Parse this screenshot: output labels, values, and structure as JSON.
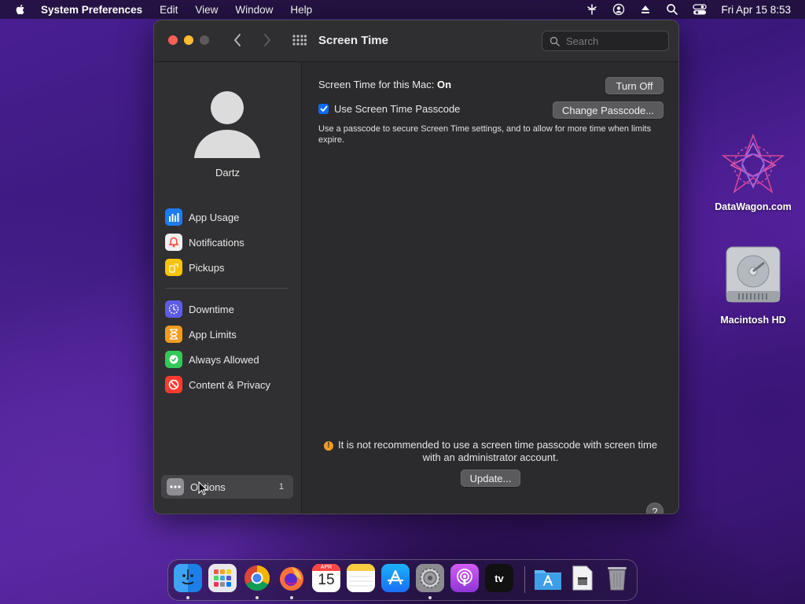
{
  "menubar": {
    "app_name": "System Preferences",
    "menus": [
      "Edit",
      "View",
      "Window",
      "Help"
    ],
    "datetime": "Fri Apr 15  8:53"
  },
  "window": {
    "title": "Screen Time",
    "search_placeholder": "Search"
  },
  "sidebar": {
    "username": "Dartz",
    "items": [
      {
        "label": "App Usage",
        "icon": "app-usage-icon",
        "color": "#1e7cf2"
      },
      {
        "label": "Notifications",
        "icon": "notifications-icon",
        "color": "#f0f0f0"
      },
      {
        "label": "Pickups",
        "icon": "pickups-icon",
        "color": "#f5c40c"
      },
      {
        "label": "Downtime",
        "icon": "downtime-icon",
        "color": "#5d5ce6"
      },
      {
        "label": "App Limits",
        "icon": "app-limits-icon",
        "color": "#f29c1f"
      },
      {
        "label": "Always Allowed",
        "icon": "always-allowed-icon",
        "color": "#34c759"
      },
      {
        "label": "Content & Privacy",
        "icon": "content-privacy-icon",
        "color": "#ff3b30"
      }
    ],
    "options": {
      "label": "Options",
      "badge": "1"
    }
  },
  "main": {
    "status_label": "Screen Time for this Mac:",
    "status_value": "On",
    "turn_off_label": "Turn Off",
    "passcode_label": "Use Screen Time Passcode",
    "passcode_checked": true,
    "change_passcode_label": "Change Passcode...",
    "description": "Use a passcode to secure Screen Time settings, and to allow for more time when limits expire.",
    "warning": "It is not recommended to use a screen time passcode with screen time with an administrator account.",
    "update_label": "Update...",
    "help_label": "?"
  },
  "desktop": {
    "icons": [
      {
        "label": "DataWagon.com",
        "icon": "datawagon-logo-icon"
      },
      {
        "label": "Macintosh HD",
        "icon": "hard-drive-icon"
      }
    ]
  },
  "dock": {
    "apps": [
      "Finder",
      "Launchpad",
      "Chrome",
      "Firefox",
      "Calendar",
      "Notes",
      "App Store",
      "System Preferences",
      "Podcasts",
      "Apple TV",
      "Applications",
      "Preview",
      "Trash"
    ],
    "calendar_month": "APR",
    "calendar_day": "15",
    "tv_label": "tv"
  }
}
